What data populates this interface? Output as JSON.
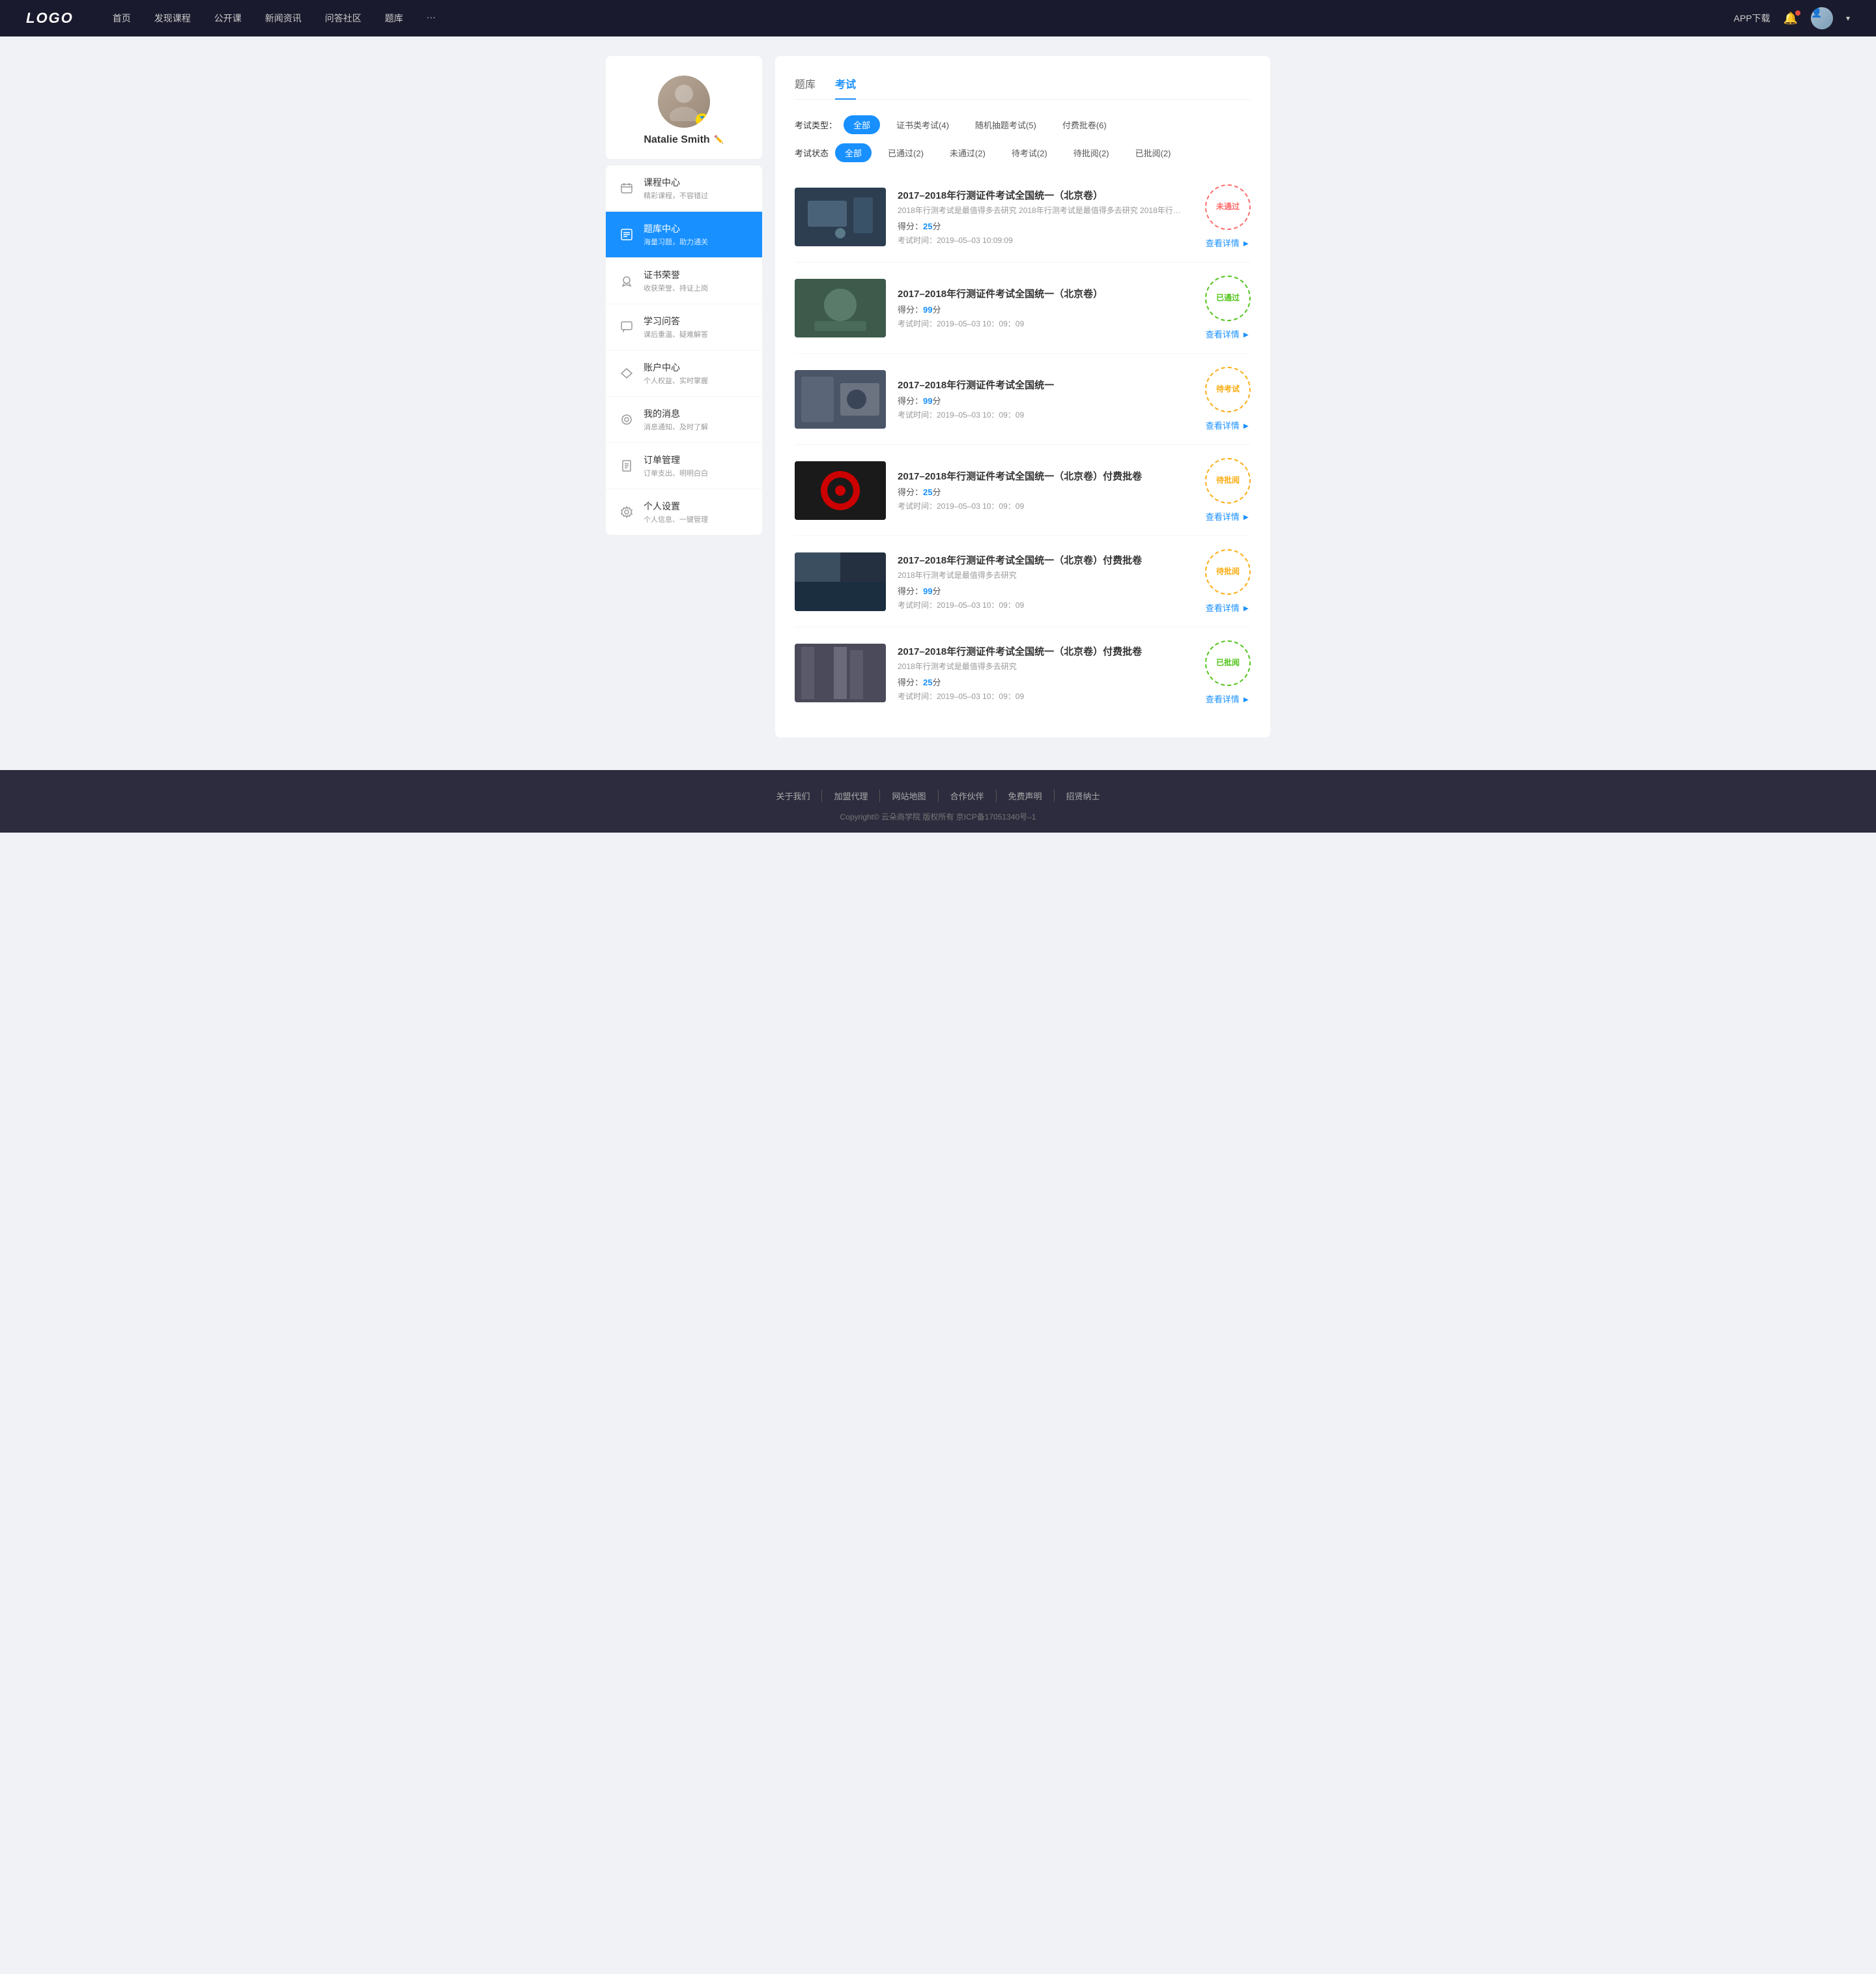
{
  "header": {
    "logo": "LOGO",
    "nav": [
      {
        "label": "首页",
        "id": "home"
      },
      {
        "label": "发现课程",
        "id": "discover"
      },
      {
        "label": "公开课",
        "id": "opencourse"
      },
      {
        "label": "新闻资讯",
        "id": "news"
      },
      {
        "label": "问答社区",
        "id": "qa"
      },
      {
        "label": "题库",
        "id": "bank"
      },
      {
        "label": "···",
        "id": "more"
      }
    ],
    "app_download": "APP下载",
    "chevron": "▾"
  },
  "sidebar": {
    "profile": {
      "name": "Natalie Smith",
      "badge": "🏅"
    },
    "menu": [
      {
        "id": "course",
        "title": "课程中心",
        "sub": "精彩课程，不容错过",
        "icon": "calendar"
      },
      {
        "id": "bank",
        "title": "题库中心",
        "sub": "海量习题，助力通关",
        "icon": "list",
        "active": true
      },
      {
        "id": "cert",
        "title": "证书荣誉",
        "sub": "收获荣誉、持证上岗",
        "icon": "badge"
      },
      {
        "id": "qa",
        "title": "学习问答",
        "sub": "课后重温、疑难解答",
        "icon": "chat"
      },
      {
        "id": "account",
        "title": "账户中心",
        "sub": "个人权益、实时掌握",
        "icon": "diamond"
      },
      {
        "id": "msg",
        "title": "我的消息",
        "sub": "消息通知、及时了解",
        "icon": "message"
      },
      {
        "id": "order",
        "title": "订单管理",
        "sub": "订单支出、明明白白",
        "icon": "doc"
      },
      {
        "id": "settings",
        "title": "个人设置",
        "sub": "个人信息、一键管理",
        "icon": "gear"
      }
    ]
  },
  "content": {
    "tabs": [
      {
        "label": "题库",
        "id": "bank"
      },
      {
        "label": "考试",
        "id": "exam",
        "active": true
      }
    ],
    "filter_type_label": "考试类型：",
    "filter_types": [
      {
        "label": "全部",
        "active": true
      },
      {
        "label": "证书类考试(4)"
      },
      {
        "label": "随机抽题考试(5)"
      },
      {
        "label": "付费批卷(6)"
      }
    ],
    "filter_status_label": "考试状态",
    "filter_statuses": [
      {
        "label": "全部",
        "active": true
      },
      {
        "label": "已通过(2)"
      },
      {
        "label": "未通过(2)"
      },
      {
        "label": "待考试(2)"
      },
      {
        "label": "待批阅(2)"
      },
      {
        "label": "已批阅(2)"
      }
    ],
    "exams": [
      {
        "id": 1,
        "title": "2017–2018年行测证件考试全国统一（北京卷）",
        "desc": "2018年行测考试是最值得多去研究 2018年行测考试是最值得多去研究 2018年行…",
        "score_label": "得分：",
        "score": "25",
        "score_unit": "分",
        "time_label": "考试时间：",
        "time": "2019–05–03  10:09:09",
        "status_text": "未通过",
        "status_class": "status-fail",
        "link": "查看详情",
        "thumb_class": "thumb-1"
      },
      {
        "id": 2,
        "title": "2017–2018年行测证件考试全国统一（北京卷）",
        "desc": "",
        "score_label": "得分：",
        "score": "99",
        "score_unit": "分",
        "time_label": "考试时间：",
        "time": "2019–05–03  10：09：09",
        "status_text": "已通过",
        "status_class": "status-pass",
        "link": "查看详情",
        "thumb_class": "thumb-2"
      },
      {
        "id": 3,
        "title": "2017–2018年行测证件考试全国统一",
        "desc": "",
        "score_label": "得分：",
        "score": "99",
        "score_unit": "分",
        "time_label": "考试时间：",
        "time": "2019–05–03  10：09：09",
        "status_text": "待考试",
        "status_class": "status-pending",
        "link": "查看详情",
        "thumb_class": "thumb-3"
      },
      {
        "id": 4,
        "title": "2017–2018年行测证件考试全国统一（北京卷）付费批卷",
        "desc": "",
        "score_label": "得分：",
        "score": "25",
        "score_unit": "分",
        "time_label": "考试时间：",
        "time": "2019–05–03  10：09：09",
        "status_text": "待批阅",
        "status_class": "status-review",
        "link": "查看详情",
        "thumb_class": "thumb-4"
      },
      {
        "id": 5,
        "title": "2017–2018年行测证件考试全国统一（北京卷）付费批卷",
        "desc": "2018年行测考试是最值得多去研究",
        "score_label": "得分：",
        "score": "99",
        "score_unit": "分",
        "time_label": "考试时间：",
        "time": "2019–05–03  10：09：09",
        "status_text": "待批阅",
        "status_class": "status-review",
        "link": "查看详情",
        "thumb_class": "thumb-5"
      },
      {
        "id": 6,
        "title": "2017–2018年行测证件考试全国统一（北京卷）付费批卷",
        "desc": "2018年行测考试是最值得多去研究",
        "score_label": "得分：",
        "score": "25",
        "score_unit": "分",
        "time_label": "考试时间：",
        "time": "2019–05–03  10：09：09",
        "status_text": "已批阅",
        "status_class": "status-reviewed",
        "link": "查看详情",
        "thumb_class": "thumb-6"
      }
    ]
  },
  "footer": {
    "links": [
      "关于我们",
      "加盟代理",
      "网站地图",
      "合作伙伴",
      "免费声明",
      "招贤纳士"
    ],
    "copyright": "Copyright© 云朵商学院  版权所有    京ICP备17051340号–1"
  }
}
